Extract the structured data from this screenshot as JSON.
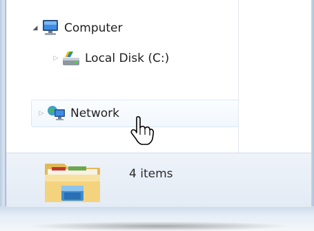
{
  "nav_tree": {
    "computer": {
      "label": "Computer",
      "icon": "computer-icon",
      "expanded": true
    },
    "local_disk": {
      "label": "Local Disk (C:)",
      "icon": "local-disk-icon",
      "expanded": false
    },
    "network": {
      "label": "Network",
      "icon": "network-icon",
      "expanded": false,
      "hovered": true
    }
  },
  "status_bar": {
    "item_count": "4 items",
    "icon": "folder-libraries-icon"
  },
  "cursor": {
    "type": "hand-pointer"
  },
  "colors": {
    "frame": "#c6d6e8",
    "hover_border": "#d9e7f5",
    "status_bg": "#e8eef6"
  }
}
